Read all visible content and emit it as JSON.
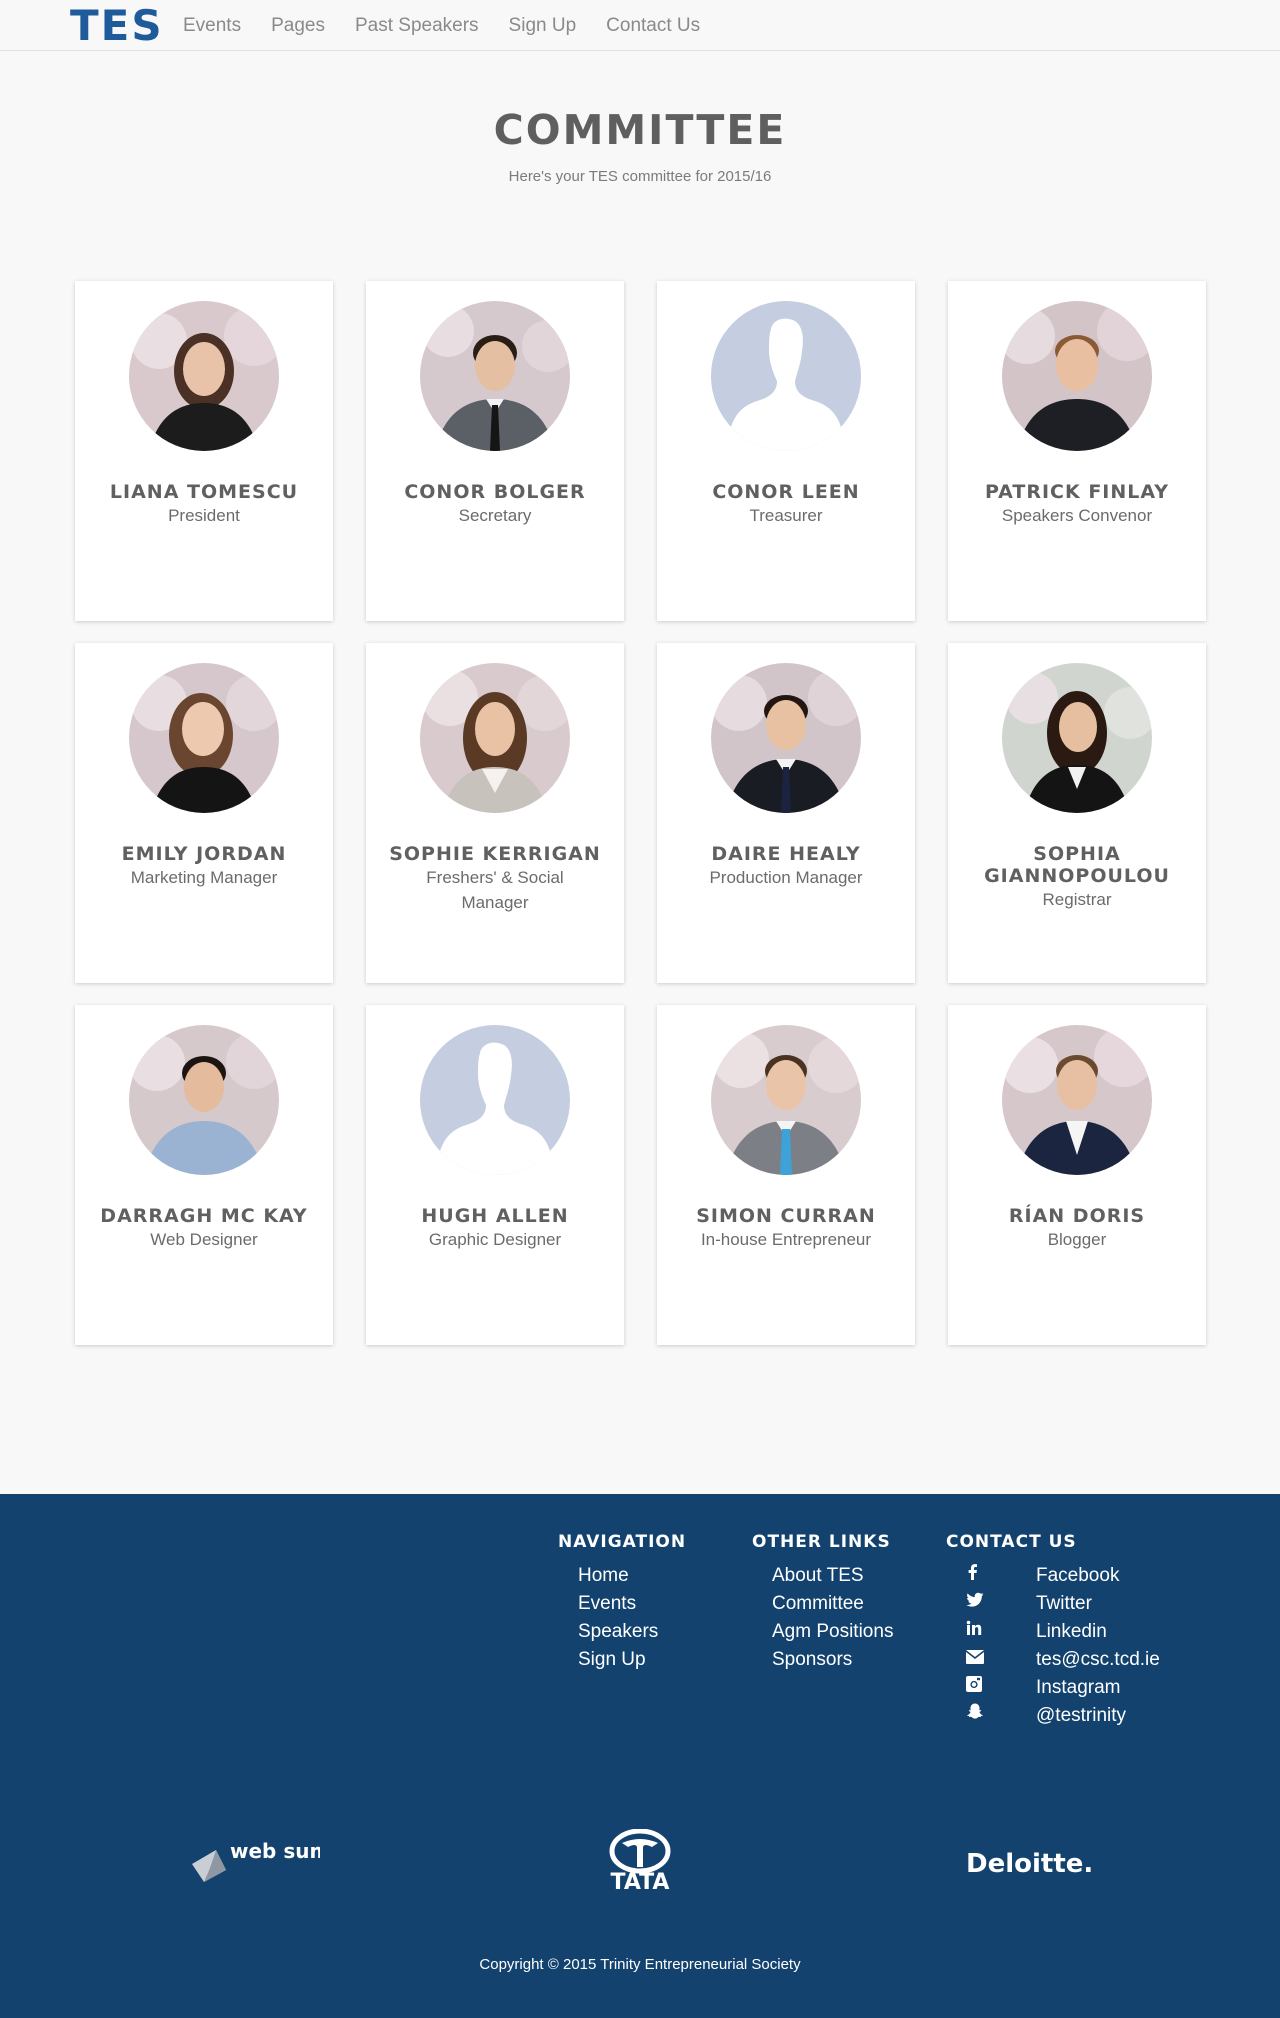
{
  "nav": {
    "brand": "TES",
    "links": [
      "Events",
      "Pages",
      "Past Speakers",
      "Sign Up",
      "Contact Us"
    ]
  },
  "header": {
    "title": "COMMITTEE",
    "subtitle": "Here's your TES committee for 2015/16"
  },
  "members": [
    {
      "name": "Liana Tomescu",
      "role": "President"
    },
    {
      "name": "Conor Bolger",
      "role": "Secretary"
    },
    {
      "name": "Conor Leen",
      "role": "Treasurer"
    },
    {
      "name": "Patrick Finlay",
      "role": "Speakers Convenor"
    },
    {
      "name": "Emily Jordan",
      "role": "Marketing Manager"
    },
    {
      "name": "Sophie Kerrigan",
      "role": "Freshers' & Social Manager"
    },
    {
      "name": "Daire Healy",
      "role": "Production Manager"
    },
    {
      "name": "Sophia Giannopoulou",
      "role": "Registrar"
    },
    {
      "name": "Darragh Mc Kay",
      "role": "Web Designer"
    },
    {
      "name": "Hugh Allen",
      "role": "Graphic Designer"
    },
    {
      "name": "Simon Curran",
      "role": "In-house Entrepreneur"
    },
    {
      "name": "Rían Doris",
      "role": "Blogger"
    }
  ],
  "footer": {
    "navigation": {
      "heading": "NAVIGATION",
      "items": [
        "Home",
        "Events",
        "Speakers",
        "Sign Up"
      ]
    },
    "other_links": {
      "heading": "OTHER LINKS",
      "items": [
        "About TES",
        "Committee",
        "Agm Positions",
        "Sponsors"
      ]
    },
    "contact": {
      "heading": "CONTACT US",
      "items": [
        {
          "icon": "facebook-icon",
          "label": "Facebook"
        },
        {
          "icon": "twitter-icon",
          "label": "Twitter"
        },
        {
          "icon": "linkedin-icon",
          "label": "Linkedin"
        },
        {
          "icon": "envelope-icon",
          "label": "tes@csc.tcd.ie"
        },
        {
          "icon": "instagram-icon",
          "label": "Instagram"
        },
        {
          "icon": "snapchat-icon",
          "label": "@testrinity"
        }
      ]
    },
    "sponsors": [
      "web summit",
      "TATA",
      "Deloitte."
    ],
    "copyright": "Copyright © 2015 Trinity Entrepreneurial Society"
  },
  "colors": {
    "footer_bg": "#12426d",
    "brand_blue": "#1f5a9a",
    "avatar_placeholder": "#c5cde0"
  }
}
